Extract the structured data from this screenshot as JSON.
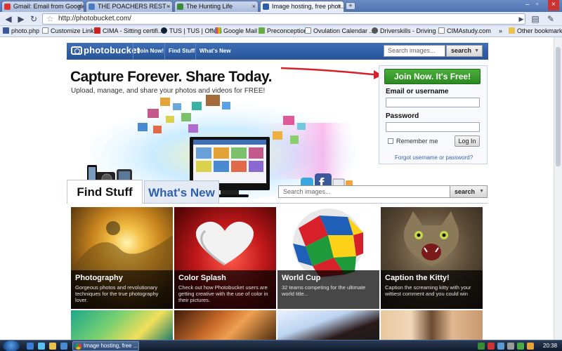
{
  "browser": {
    "tabs": [
      {
        "label": "Gmail: Email from Google",
        "active": false
      },
      {
        "label": "THE POACHERS REST - P...",
        "active": false
      },
      {
        "label": "The Hunting Life",
        "active": false
      },
      {
        "label": "Image hosting, free phot...",
        "active": true
      }
    ],
    "new_tab_label": "+",
    "address": "http://photobucket.com/",
    "bookmarks": [
      "photo.php",
      "Customize Links",
      "CIMA - Sitting certifi...",
      "TUS | TUS | Offers",
      "Google Mail",
      "Preconception",
      "Ovulation Calendar ...",
      "Driverskills - Driving ...",
      "CIMAstudy.com"
    ],
    "other_bookmarks": "Other bookmarks",
    "overflow": "»"
  },
  "site": {
    "logo": "photobucket",
    "nav": [
      "Join Now!",
      "Find Stuff",
      "What's New"
    ],
    "header_search_placeholder": "Search images...",
    "header_search_button": "search",
    "headline": "Capture Forever. Share Today.",
    "subline": "Upload, manage, and share your photos and videos for FREE!",
    "join_button": "Join Now. It's Free!",
    "email_label": "Email or username",
    "password_label": "Password",
    "remember_label": "Remember me",
    "login_button": "Log In",
    "forgot_link": "Forgot username or password?",
    "tab_find": "Find Stuff",
    "tab_new": "What's New",
    "body_search_placeholder": "Search images...",
    "body_search_button": "search",
    "tiles": [
      {
        "title": "Photography",
        "desc": "Gorgeous photos and revolutionary techniques for the true photography lover."
      },
      {
        "title": "Color Splash",
        "desc": "Check out how Photobucket users are getting creative with the use of color in their pictures."
      },
      {
        "title": "World Cup",
        "desc": "32 teams competing for the ultimate world title..."
      },
      {
        "title": "Caption the Kitty!",
        "desc": "Caption the screaming kitty with your wittiest comment and you could win"
      }
    ]
  },
  "taskbar": {
    "task_label": "Image hosting, free ...",
    "clock": "20:38"
  },
  "colors": {
    "brand_blue": "#2f5ea6",
    "join_green": "#2a8a22",
    "arrow_red": "#d8202a"
  }
}
